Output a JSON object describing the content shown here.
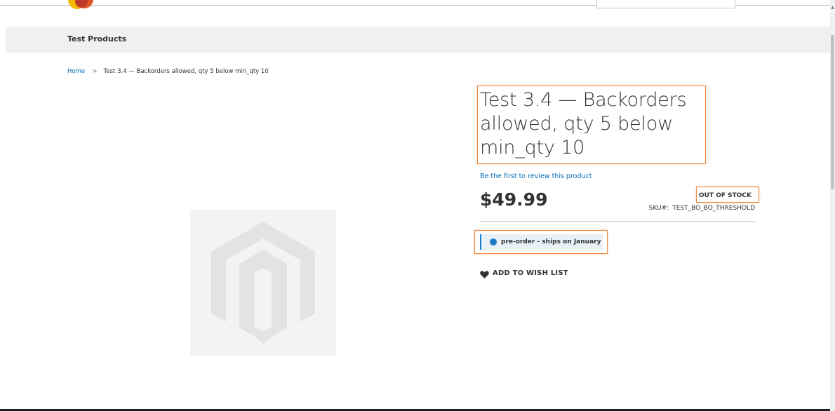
{
  "header": {
    "nav_item": "Test Products"
  },
  "breadcrumbs": {
    "home": "Home",
    "separator": ">",
    "current": "Test 3.4 — Backorders allowed, qty 5 below min_qty 10"
  },
  "product": {
    "title": "Test 3.4 — Backorders allowed, qty 5 below min_qty 10",
    "review_link": "Be the first to review this product",
    "price": "$49.99",
    "stock_status": "OUT OF STOCK",
    "sku_label": "SKU#:",
    "sku_value": "TEST_BO_BO_THRESHOLD",
    "preorder_note": "pre-order - ships on January",
    "wishlist_label": "ADD TO WISH LIST"
  },
  "colors": {
    "link": "#006bb4",
    "highlight_outline": "#f0873a",
    "preorder_accent": "#1979c3",
    "nav_background": "#f0f0f0"
  },
  "icons": [
    "logo-icon",
    "placeholder-image-icon",
    "info-dot-icon",
    "heart-icon",
    "scroll-up-arrow-icon"
  ]
}
